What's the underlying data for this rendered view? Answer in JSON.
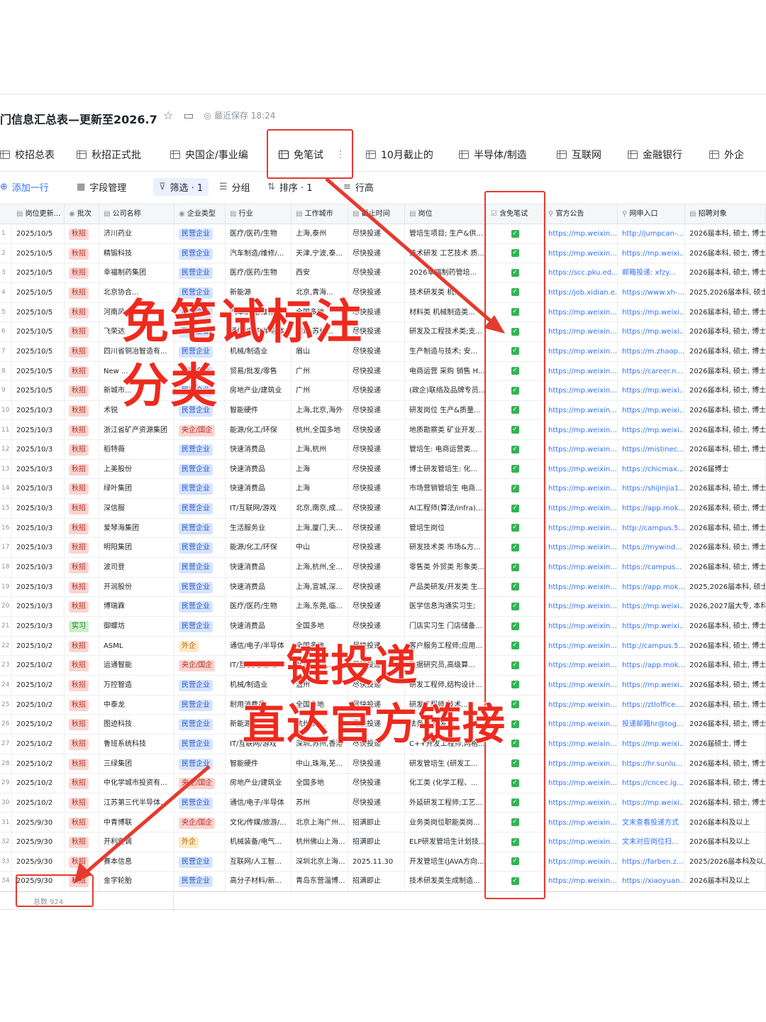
{
  "document": {
    "title": "门信息汇总表—更新至2026.7",
    "save_status": "最近保存 18:24"
  },
  "view_tabs": [
    {
      "label": "校招总表"
    },
    {
      "label": "秋招正式批"
    },
    {
      "label": "央国企/事业编"
    },
    {
      "label": "免笔试",
      "active": true
    },
    {
      "label": "10月截止的"
    },
    {
      "label": "半导体/制造"
    },
    {
      "label": "互联网"
    },
    {
      "label": "金融银行"
    },
    {
      "label": "外企"
    }
  ],
  "toolbar": {
    "add_row": "添加一行",
    "fields": "字段管理",
    "filter": "筛选 · 1",
    "group": "分组",
    "sort": "排序 · 1",
    "row_height": "行高"
  },
  "columns": [
    "岗位更新...",
    "批次",
    "公司名称",
    "企业类型",
    "行业",
    "工作城市",
    "截止时间",
    "岗位",
    "含免笔试",
    "官方公告",
    "网申入口",
    "招聘对象"
  ],
  "rows": [
    [
      "1",
      "2025/10/5",
      "秋招",
      "济川药业",
      "民营企业",
      "医疗/医药/生物",
      "上海,泰州",
      "尽快投递",
      "管培生项目; 生产&供...",
      "https://mp.weixin....",
      "http://jumpcan-...",
      "2026届本科, 硕士, 博士"
    ],
    [
      "2",
      "2025/10/5",
      "秋招",
      "精锻科技",
      "民营企业",
      "汽车制造/维修/...",
      "天津,宁波,泰...",
      "尽快投递",
      "技术研发 工艺技术 质...",
      "https://mp.weixin....",
      "https://mp.weixi...",
      "2026届本科, 硕士, 博士"
    ],
    [
      "3",
      "2025/10/5",
      "秋招",
      "幸福制药集团",
      "民营企业",
      "医疗/医药/生物",
      "西安",
      "尽快投递",
      "2026幸福制药管培...",
      "https://scc.pku.ed...",
      "邮箱投递: xfzy...",
      "2026届本科, 硕士, 博士"
    ],
    [
      "4",
      "2025/10/5",
      "秋招",
      "北京协合...",
      "民营企业",
      "新能源",
      "北京,青海...",
      "尽快投递",
      "技术研发类 机...",
      "https://job.xidian.e...",
      "https://www.xh-...",
      "2025,2026届本科, 硕士"
    ],
    [
      "5",
      "2025/10/5",
      "秋招",
      "河南风...",
      "民营企业",
      "汽车制造/维修...",
      "全国多地",
      "尽快投递",
      "材料类 机械制造类...",
      "https://mp.weixin....",
      "https://mp.weixi...",
      "2026届本科, 硕士, 博士"
    ],
    [
      "6",
      "2025/10/5",
      "秋招",
      "飞荣达",
      "民营企业",
      "通信/电子/半导体",
      "深圳,苏州...",
      "尽快投递",
      "研发及工程技术类;支...",
      "https://mp.weixin....",
      "https://mp.weixi...",
      "2026届本科, 硕士, 博士"
    ],
    [
      "7",
      "2025/10/5",
      "秋招",
      "四川省铜冶智造有...",
      "民营企业",
      "机械/制造业",
      "眉山",
      "尽快投递",
      "生产制造与技术; 安...",
      "https://mp.weixin....",
      "https://m.zhaop...",
      "2026届本科, 硕士, 博士"
    ],
    [
      "8",
      "2025/10/5",
      "秋招",
      "New ...",
      "民营企业",
      "贸易/批发/零售",
      "广州",
      "尽快投递",
      "电商运营 采购 销售 H...",
      "https://mp.weixin....",
      "https://career.n...",
      "2026届本科, 硕士, 博士"
    ],
    [
      "9",
      "2025/10/5",
      "秋招",
      "新城市...",
      "民营企业",
      "房地产业/建筑业",
      "广州",
      "尽快投递",
      "(政企)联络及品牌专员...",
      "https://mp.weixin....",
      "https://mp.weixi...",
      "2026届本科, 硕士, 博士"
    ],
    [
      "10",
      "2025/10/3",
      "秋招",
      "术锐",
      "民营企业",
      "智能硬件",
      "上海,北京,海外",
      "尽快投递",
      "研发岗位 生产&质量...",
      "https://mp.weixin....",
      "https://mp.weixi...",
      "2026届本科, 硕士, 博士"
    ],
    [
      "11",
      "2025/10/3",
      "秋招",
      "浙江省矿产资源集团",
      "央企/国企",
      "能源/化工/环保",
      "杭州,全国多地",
      "尽快投递",
      "地质勘察类 矿业开发...",
      "https://mp.weixin....",
      "https://mp.weixi...",
      "2026届本科, 硕士, 博士"
    ],
    [
      "12",
      "2025/10/3",
      "秋招",
      "稻特薇",
      "民营企业",
      "快速消费品",
      "上海,杭州",
      "尽快投递",
      "管培生: 电商运营类...",
      "https://mp.weixin....",
      "https://mistinec...",
      "2026届本科, 硕士, 博士"
    ],
    [
      "13",
      "2025/10/3",
      "秋招",
      "上美股份",
      "民营企业",
      "快速消费品",
      "上海",
      "尽快投递",
      "博士研发管培生: 化...",
      "https://mp.weixin....",
      "https://chicmax...",
      "2026届博士"
    ],
    [
      "14",
      "2025/10/3",
      "秋招",
      "绿叶集团",
      "民营企业",
      "快速消费品",
      "上海",
      "尽快投递",
      "市场营销管培生 电商...",
      "https://mp.weixin....",
      "https://shijinjia1...",
      "2026届本科, 硕士, 博士"
    ],
    [
      "15",
      "2025/10/3",
      "秋招",
      "深信服",
      "民营企业",
      "IT/互联网/游戏",
      "北京,南京,成...",
      "尽快投递",
      "AI工程师(算法/infra)...",
      "https://mp.weixin....",
      "https://app.mok...",
      "2026届本科, 硕士, 博士"
    ],
    [
      "16",
      "2025/10/3",
      "秋招",
      "爱琴海集团",
      "民营企业",
      "生活服务业",
      "上海,厦门,天...",
      "尽快投递",
      "管培生岗位",
      "https://mp.weixin....",
      "http://campus.5...",
      "2026届本科, 硕士, 博士"
    ],
    [
      "17",
      "2025/10/3",
      "秋招",
      "明阳集团",
      "民营企业",
      "能源/化工/环保",
      "中山",
      "尽快投递",
      "研发技术类 市场&方...",
      "https://mp.weixin....",
      "https://mywind...",
      "2026届本科, 硕士, 博士"
    ],
    [
      "18",
      "2025/10/3",
      "秋招",
      "波司登",
      "民营企业",
      "快速消费品",
      "上海,杭州,全...",
      "尽快投递",
      "零售类 外贸类 形象类...",
      "https://mp.weixin....",
      "https://campus...",
      "2026届本科, 硕士, 博士"
    ],
    [
      "19",
      "2025/10/3",
      "秋招",
      "开润股份",
      "民营企业",
      "快速消费品",
      "上海,宣城,深...",
      "尽快投递",
      "产品类研发/开发类 生...",
      "https://mp.weixin....",
      "https://app.mok...",
      "2025,2026届本科, 硕士"
    ],
    [
      "20",
      "2025/10/3",
      "秋招",
      "博瑞霖",
      "民营企业",
      "医疗/医药/生物",
      "上海,东莞,临...",
      "尽快投递",
      "医学信息沟通实习生;",
      "https://mp.weixin....",
      "https://mp.weixi...",
      "2026,2027届大专, 本科"
    ],
    [
      "21",
      "2025/10/3",
      "实习",
      "御蝶坊",
      "民营企业",
      "快速消费品",
      "全国多地",
      "尽快投递",
      "门店实习生 门店储备...",
      "https://mp.weixin....",
      "https://mp.weixi...",
      "2026届本科, 硕士, 博士"
    ],
    [
      "22",
      "2025/10/2",
      "秋招",
      "ASML",
      "外企",
      "通信/电子/半导体",
      "全国多地",
      "尽快投递",
      "客户服务工程师;应用...",
      "https://mp.weixin....",
      "http://campus.5...",
      "2026届本科, 硕士, 博士"
    ],
    [
      "23",
      "2025/10/2",
      "秋招",
      "运通智能",
      "央企/国企",
      "IT/互联网/游戏",
      "北京,上海...",
      "尽快投递",
      "数据研究员,高级算...",
      "https://mp.weixin....",
      "https://app.mok...",
      "2026届本科, 硕士, 博士"
    ],
    [
      "24",
      "2025/10/2",
      "秋招",
      "万控智造",
      "民营企业",
      "机械/制造业",
      "温州",
      "尽快投递",
      "研发工程师,结构设计...",
      "https://mp.weixin....",
      "https://mp.weixi...",
      "2026届本科, 硕士, 博士"
    ],
    [
      "25",
      "2025/10/2",
      "秋招",
      "中泰龙",
      "民营企业",
      "耐用消费品",
      "全国多地",
      "尽快投递",
      "研发工程师 技术...",
      "https://mp.weixin....",
      "https://ztloffice....",
      "2026届本科, 硕士, 博士"
    ],
    [
      "26",
      "2025/10/2",
      "秋招",
      "图迹科技",
      "民营企业",
      "新能源",
      "杭州,深...",
      "尽快投递",
      "法务类 研发类...",
      "https://mp.weixin....",
      "投递邮箱hr@tog...",
      "2026届本科, 硕士, 博士"
    ],
    [
      "27",
      "2025/10/2",
      "秋招",
      "鲁班系统科技",
      "民营企业",
      "IT/互联网/游戏",
      "深圳,苏州,香港",
      "尽快投递",
      "C++开发工程师,网格...",
      "https://mp.weixin....",
      "https://mp.weixi...",
      "2026届硕士, 博士"
    ],
    [
      "28",
      "2025/10/2",
      "秋招",
      "三绿集团",
      "民营企业",
      "智能硬件",
      "中山,珠海,芜...",
      "尽快投递",
      "研发管培生 (研发工...",
      "https://mp.weixin....",
      "https://hr.sunlu...",
      "2026届本科, 硕士, 博士"
    ],
    [
      "29",
      "2025/10/2",
      "秋招",
      "中化学城市投资有...",
      "央企/国企",
      "房地产业/建筑业",
      "全国多地",
      "尽快投递",
      "化工类 (化学工程、...",
      "https://mp.weixin....",
      "https://cncec.ig...",
      "2026届本科, 硕士, 博士"
    ],
    [
      "30",
      "2025/10/2",
      "秋招",
      "江苏第三代半导体...",
      "民营企业",
      "通信/电子/半导体",
      "苏州",
      "尽快投递",
      "外延研发工程师;工艺...",
      "https://mp.weixin....",
      "https://mp.weixi...",
      "2026届本科, 硕士, 博士"
    ],
    [
      "31",
      "2025/9/30",
      "秋招",
      "中青博联",
      "央企/国企",
      "文化/传媒/旅游/...",
      "北京上海广州...",
      "招满即止",
      "业务类岗位职能类岗...",
      "https://mp.weixin....",
      "文末查看投递方式",
      "2026届本科及以上"
    ],
    [
      "32",
      "2025/9/30",
      "秋招",
      "开利空调",
      "外企",
      "机械装备/电气...",
      "杭州佛山上海...",
      "招满即止",
      "ELP研发管培生计划技...",
      "https://mp.weixin....",
      "文末对应岗位扫...",
      "2026届本科及以上"
    ],
    [
      "33",
      "2025/9/30",
      "秋招",
      "赛本信息",
      "民营企业",
      "互联网/人工智...",
      "深圳北京上海...",
      "2025.11.30",
      "开发管培生(JAVA方向...",
      "https://mp.weixin....",
      "https://farben.z...",
      "2025/2026届本科及以上"
    ],
    [
      "34",
      "2025/9/30",
      "秋招",
      "金字轮胎",
      "民营企业",
      "高分子材料/新...",
      "青岛东营淄博...",
      "招满即止",
      "技术研发类生成制造...",
      "https://mp.weixin....",
      "https://xiaoyuan...",
      "2026届本科及以上"
    ]
  ],
  "footer": {
    "total": "总数 924"
  },
  "annotations": {
    "label1_line1": "免笔试标注",
    "label1_line2": "分类",
    "label2_line1": "一键投递",
    "label2_line2": "直达官方链接"
  },
  "colors": {
    "accent": "#3370ff",
    "annotation_red": "#ee2a1e",
    "check_green": "#34b356"
  }
}
